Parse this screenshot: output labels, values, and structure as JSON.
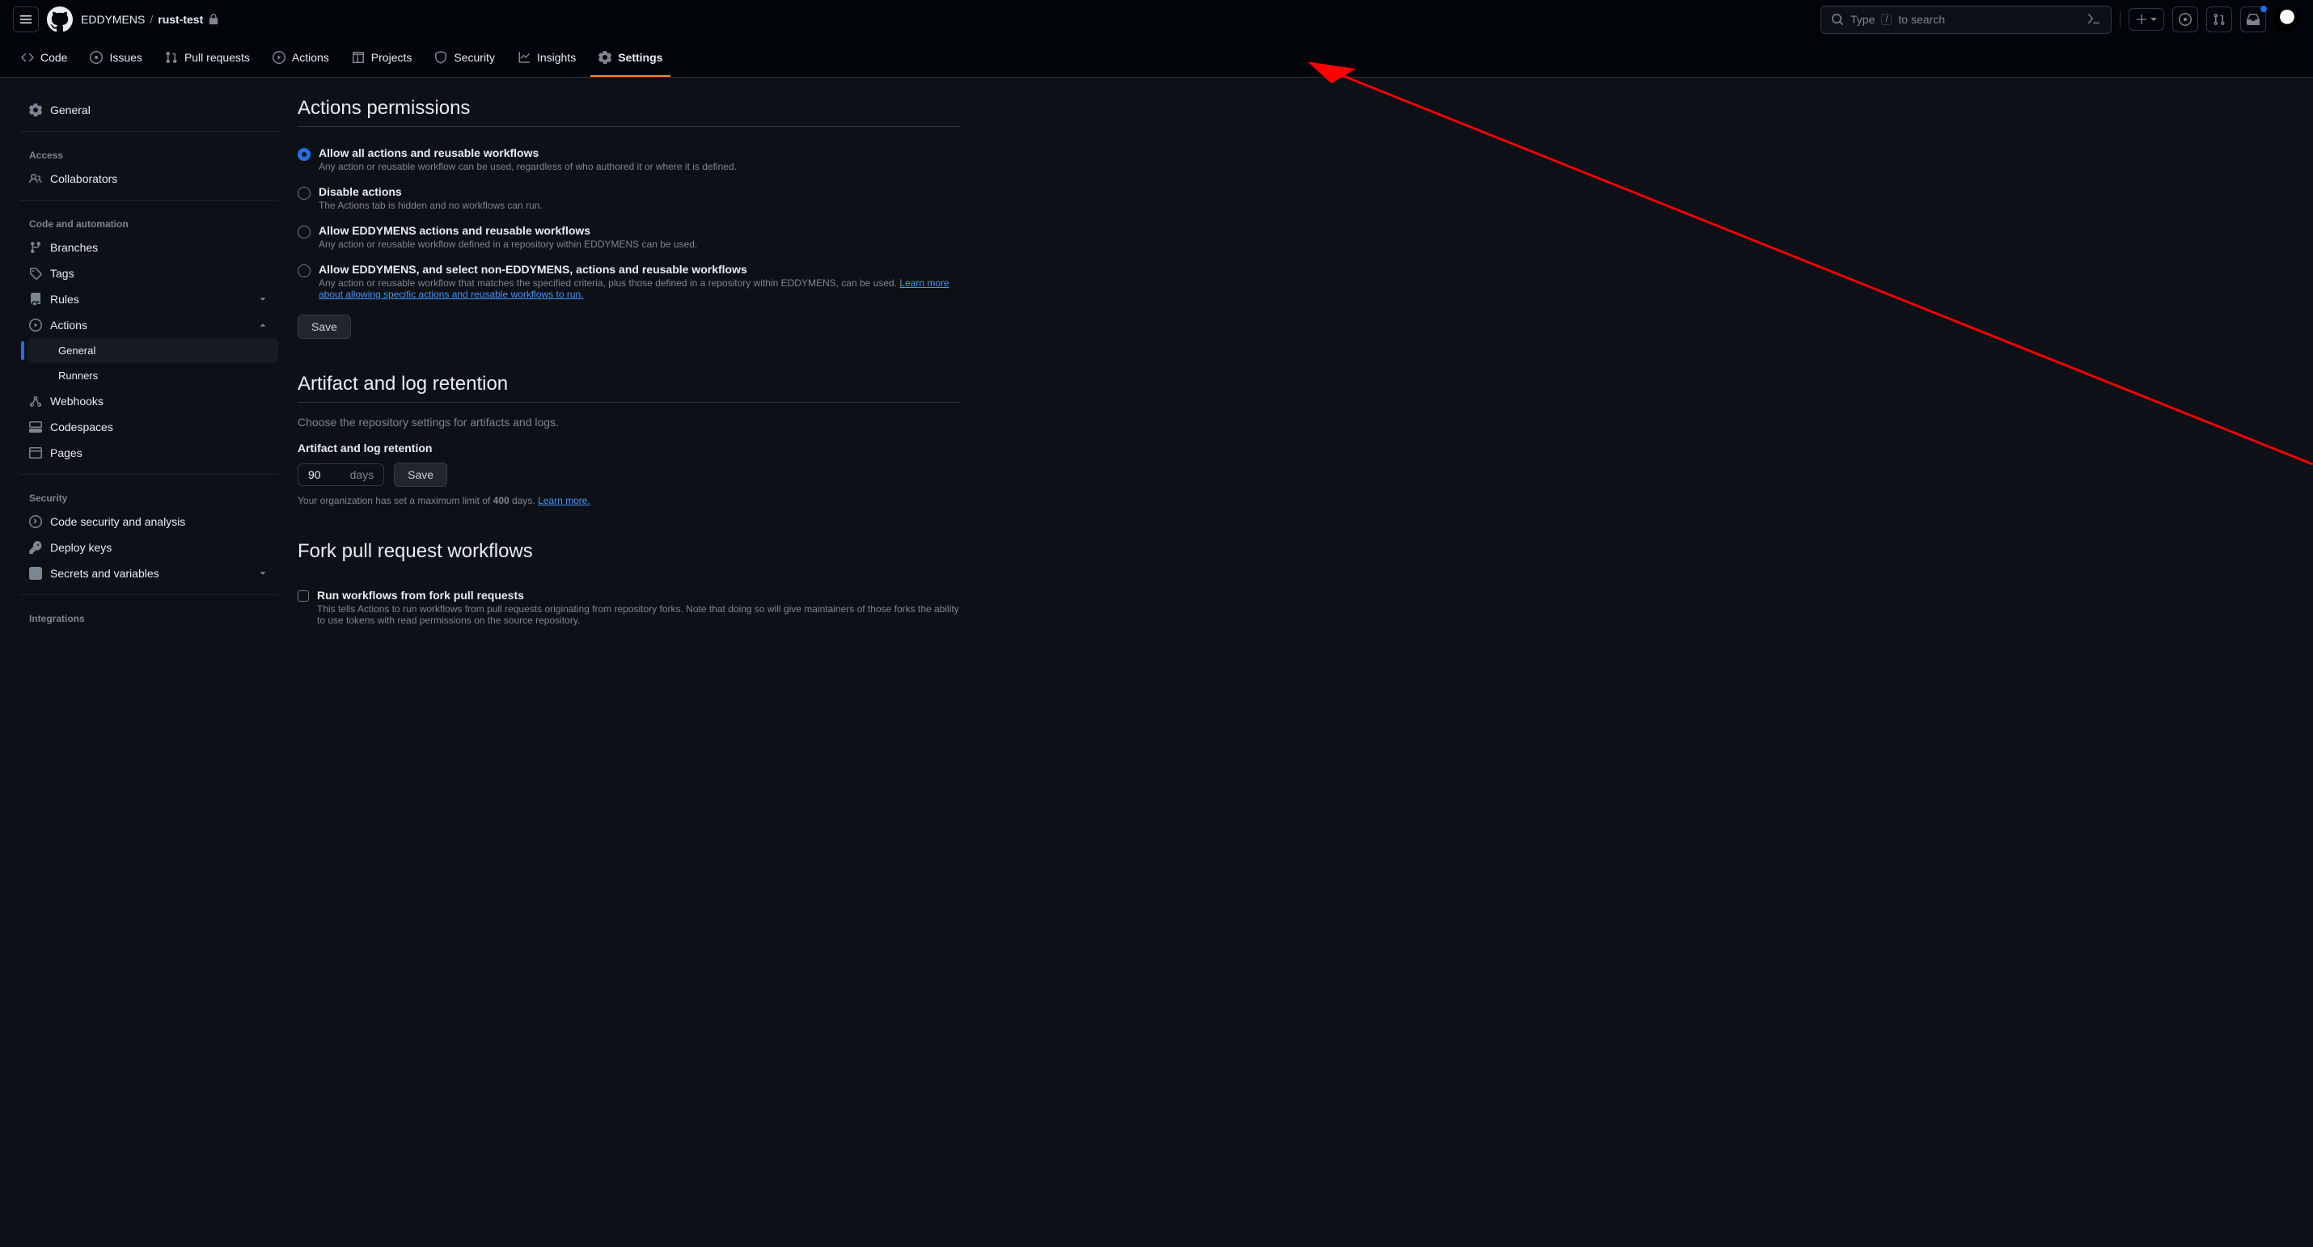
{
  "header": {
    "owner": "EDDYMENS",
    "separator": "/",
    "repo": "rust-test",
    "search_prefix": "Type",
    "search_key": "/",
    "search_suffix": "to search"
  },
  "repo_nav": {
    "code": "Code",
    "issues": "Issues",
    "pull_requests": "Pull requests",
    "actions": "Actions",
    "projects": "Projects",
    "security": "Security",
    "insights": "Insights",
    "settings": "Settings"
  },
  "sidebar": {
    "general": "General",
    "access_heading": "Access",
    "collaborators": "Collaborators",
    "code_heading": "Code and automation",
    "branches": "Branches",
    "tags": "Tags",
    "rules": "Rules",
    "actions": "Actions",
    "actions_general": "General",
    "actions_runners": "Runners",
    "webhooks": "Webhooks",
    "codespaces": "Codespaces",
    "pages": "Pages",
    "security_heading": "Security",
    "code_security": "Code security and analysis",
    "deploy_keys": "Deploy keys",
    "secrets": "Secrets and variables",
    "integrations_heading": "Integrations"
  },
  "main": {
    "permissions": {
      "title": "Actions permissions",
      "allow_all_label": "Allow all actions and reusable workflows",
      "allow_all_desc": "Any action or reusable workflow can be used, regardless of who authored it or where it is defined.",
      "disable_label": "Disable actions",
      "disable_desc": "The Actions tab is hidden and no workflows can run.",
      "allow_owner_label": "Allow EDDYMENS actions and reusable workflows",
      "allow_owner_desc": "Any action or reusable workflow defined in a repository within EDDYMENS can be used.",
      "allow_select_label": "Allow EDDYMENS, and select non-EDDYMENS, actions and reusable workflows",
      "allow_select_desc_a": "Any action or reusable workflow that matches the specified criteria, plus those defined in a repository within EDDYMENS, can be used. ",
      "allow_select_link": "Learn more about allowing specific actions and reusable workflows to run.",
      "save": "Save"
    },
    "retention": {
      "title": "Artifact and log retention",
      "desc": "Choose the repository settings for artifacts and logs.",
      "field_label": "Artifact and log retention",
      "value": "90",
      "unit": "days",
      "save": "Save",
      "hint_a": "Your organization has set a maximum limit of ",
      "hint_max": "400",
      "hint_b": " days. ",
      "hint_link": "Learn more."
    },
    "fork": {
      "title": "Fork pull request workflows",
      "checkbox_label": "Run workflows from fork pull requests",
      "checkbox_desc": "This tells Actions to run workflows from pull requests originating from repository forks. Note that doing so will give maintainers of those forks the ability to use tokens with read permissions on the source repository."
    }
  }
}
